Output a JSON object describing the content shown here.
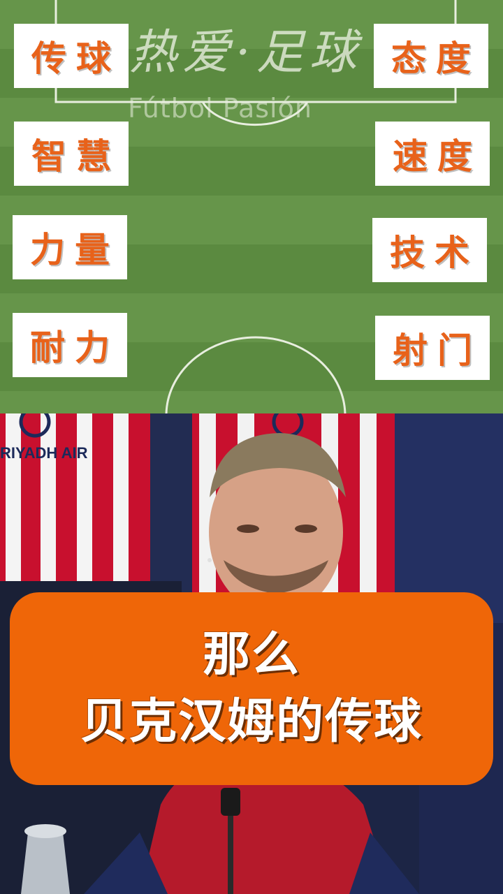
{
  "watermark": {
    "title": "热爱·足球",
    "subtitle": "Fútbol Pasión"
  },
  "attributes": {
    "left": [
      "传球",
      "智慧",
      "力量",
      "耐力"
    ],
    "right": [
      "态度",
      "速度",
      "技术",
      "射门"
    ]
  },
  "video": {
    "sponsor_text": "RIYADH AIR"
  },
  "caption": {
    "line1": "那么",
    "line2": "贝克汉姆的传球"
  },
  "colors": {
    "attribute_text": "#e8621a",
    "caption_bg": "#ef6608",
    "pitch_green": "#66954a"
  }
}
